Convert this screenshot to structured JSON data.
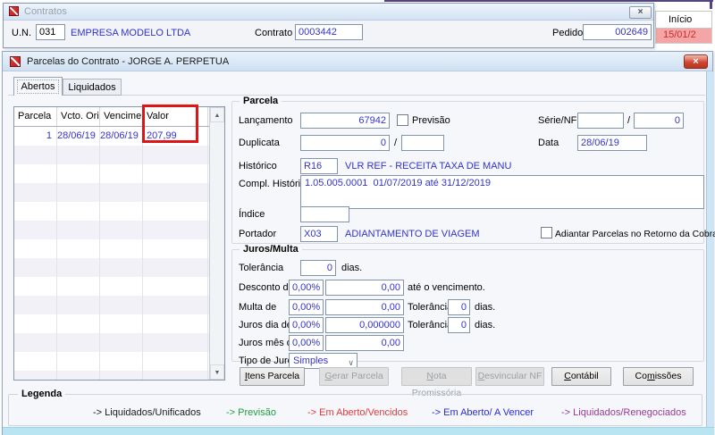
{
  "background_window": {
    "inicio_header": "Início",
    "inicio_row_value": "15/01/2"
  },
  "contratos": {
    "title": "Contratos",
    "close_glyph": "×",
    "un_label": "U.N.",
    "un_value": "031",
    "company_name": "EMPRESA MODELO LTDA",
    "contrato_label": "Contrato",
    "contrato_value": "0003442",
    "pedido_label": "Pedido",
    "pedido_value": "002649"
  },
  "parcelas": {
    "title": "Parcelas do Contrato - JORGE A. PERPETUA",
    "close_glyph": "×",
    "tabs": [
      {
        "label": "Abertos",
        "active": true
      },
      {
        "label": "Liquidados",
        "active": false
      }
    ],
    "table": {
      "columns": [
        "Parcela",
        "Vcto. Orig",
        "Vencimento",
        "Valor"
      ],
      "rows": [
        [
          "1",
          "28/06/19",
          "28/06/19",
          "207,99"
        ]
      ],
      "empty_row_count": 13
    },
    "parcela_group": {
      "title": "Parcela",
      "lancamento_label": "Lançamento",
      "lancamento_value": "67942",
      "previsao_label": "Previsão",
      "serie_nf_label": "Série/NF",
      "serie_nf_value1": "",
      "serie_nf_separator": "/",
      "serie_nf_value2": "0",
      "duplicata_label": "Duplicata",
      "duplicata_value1": "0",
      "duplicata_separator": "/",
      "duplicata_value2": "",
      "data_label": "Data",
      "data_value": "28/06/19",
      "historico_label": "Histórico",
      "historico_code": "R16",
      "historico_desc": "VLR REF - RECEITA TAXA DE MANU",
      "compl_historico_label": "Compl. Histórico",
      "compl_historico_value": "1.05.005.0001  01/07/2019 até 31/12/2019",
      "indice_label": "Índice",
      "indice_value": "",
      "portador_label": "Portador",
      "portador_code": "X03",
      "portador_desc": "ADIANTAMENTO DE VIAGEM",
      "adiantar_label": "Adiantar Parcelas no Retorno da Cobrança"
    },
    "juros_group": {
      "title": "Juros/Multa",
      "tolerancia_label": "Tolerância",
      "tolerancia_value": "0",
      "dias_label": "dias.",
      "desconto_label": "Desconto de",
      "desconto_pct": "0,00%",
      "desconto_valor": "0,00",
      "ate_vencimento_label": "até o vencimento.",
      "multa_label": "Multa de",
      "multa_pct": "0,00%",
      "multa_valor": "0,00",
      "multa_tolerancia_label": "Tolerância",
      "multa_tolerancia_value": "0",
      "multa_dias_label": "dias.",
      "juros_dia_label": "Juros dia de",
      "juros_dia_pct": "0,00%",
      "juros_dia_valor": "0,000000",
      "juros_dia_tolerancia_label": "Tolerância",
      "juros_dia_tolerancia_value": "0",
      "juros_dia_dias_label": "dias.",
      "juros_mes_label": "Juros mês de",
      "juros_mes_pct": "0,00%",
      "juros_mes_valor": "0,00",
      "tipo_juros_label": "Tipo de Juros",
      "tipo_juros_value": "Simples"
    },
    "buttons": [
      {
        "name": "itens-parcela-button",
        "label": "Itens Parcela",
        "underline": 0,
        "enabled": true
      },
      {
        "name": "gerar-parcela-button",
        "label": "Gerar Parcela",
        "underline": 0,
        "enabled": false
      },
      {
        "name": "nota-promissoria-button",
        "label": "Nota Promissória",
        "underline": 0,
        "enabled": false
      },
      {
        "name": "desvincular-nf-button",
        "label": "Desvincular NF",
        "underline": 0,
        "enabled": false
      },
      {
        "name": "contabil-button",
        "label": "Contábil",
        "underline": 0,
        "enabled": true
      },
      {
        "name": "comissoes-button",
        "label": "Comissões",
        "underline": 2,
        "enabled": true
      }
    ]
  },
  "legend": {
    "title": "Legenda",
    "items": [
      {
        "label": "-> Liquidados/Unificados",
        "color": "#1a1a1a"
      },
      {
        "label": "-> Previsão",
        "color": "#1f9e3f"
      },
      {
        "label": "-> Em Aberto/Vencidos",
        "color": "#e33b3b"
      },
      {
        "label": "-> Em Aberto/ A Vencer",
        "color": "#2a2ae0"
      },
      {
        "label": "-> Liquidados/Renegociados",
        "color": "#993a99"
      }
    ]
  },
  "colors": {
    "value_text": "#3333cc",
    "annotation_red": "#e01414",
    "pink_row_bg": "#f4a6a6",
    "pink_row_text": "#cc2a2a",
    "bottom_bar": "#b9e4f1"
  }
}
